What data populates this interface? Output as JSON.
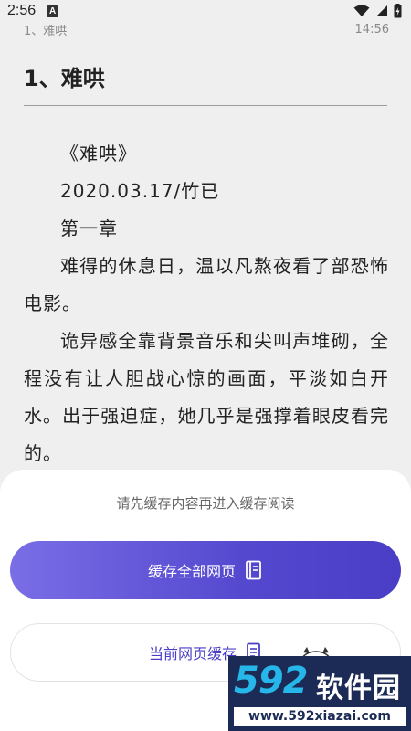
{
  "status_bar": {
    "time": "2:56",
    "notification_icon": "A"
  },
  "reader": {
    "header_chapter": "1、难哄",
    "header_time": "14:56",
    "chapter_title": "1、难哄",
    "paragraphs": [
      "《难哄》",
      "2020.03.17/竹已",
      "第一章",
      "难得的休息日，温以凡熬夜看了部恐怖电影。",
      "诡异感全靠背景音乐和尖叫声堆砌，全程没有让人胆战心惊的画面，平淡如白开水。出于强迫症，她几乎是强撑着眼皮看完的。"
    ]
  },
  "sheet": {
    "hint": "请先缓存内容再进入缓存阅读",
    "cache_all_label": "缓存全部网页",
    "cache_current_label": "当前网页缓存"
  },
  "watermark": {
    "logo": "592",
    "name": "软件园",
    "url": "www.592xiazai.com"
  },
  "colors": {
    "accent_start": "#7a6ee6",
    "accent_end": "#4a3ec6",
    "reader_background": "#efefef"
  },
  "icons": {
    "wifi": "wifi-icon",
    "signal": "signal-icon",
    "battery": "battery-icon",
    "cache_all": "book-icon",
    "cache_current": "document-icon"
  }
}
